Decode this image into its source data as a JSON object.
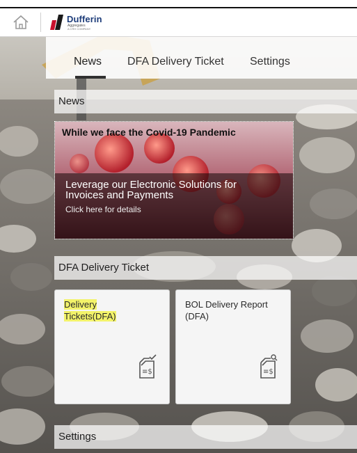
{
  "shell": {
    "home_icon": "home-icon",
    "logo": {
      "name": "Dufferin",
      "sub": "Aggregates",
      "sub2": "A CRH COMPANY",
      "brand_color": "#1e3d7a",
      "accent_color": "#c8102e"
    }
  },
  "tabs": [
    {
      "label": "News",
      "selected": true
    },
    {
      "label": "DFA Delivery Ticket",
      "selected": false
    },
    {
      "label": "Settings",
      "selected": false
    }
  ],
  "sections": {
    "news": "News",
    "dfa": "DFA Delivery Ticket",
    "settings": "Settings"
  },
  "news_tile": {
    "headline": "While we face the Covid-19 Pandemic",
    "body": "Leverage our Electronic Solutions for Invoices and Payments",
    "link": "Click here for details"
  },
  "tiles": [
    {
      "title": "Delivery Tickets(DFA)",
      "icon": "invoice-check-icon",
      "highlighted": true,
      "highlight_color": "#f3f36a"
    },
    {
      "title": "BOL Delivery Report (DFA)",
      "icon": "invoice-search-icon",
      "highlighted": false
    }
  ]
}
